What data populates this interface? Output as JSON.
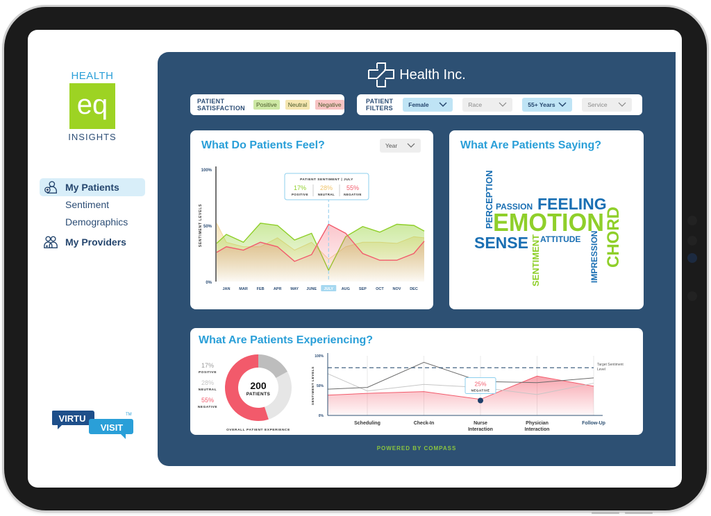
{
  "sidebar": {
    "logo": {
      "top": "HEALTH",
      "mark": "eq",
      "bottom": "INSIGHTS"
    },
    "nav": [
      {
        "label": "My Patients",
        "icon": "patient-icon",
        "active": true
      },
      {
        "label": "Sentiment"
      },
      {
        "label": "Demographics"
      },
      {
        "label": "My Providers",
        "icon": "providers-icon",
        "active": false
      }
    ],
    "partner_logo": {
      "part1": "VIRTU",
      "part2": "VISIT",
      "tm": "TM"
    }
  },
  "header": {
    "brand": "Health Inc."
  },
  "satisfaction": {
    "label_line1": "PATIENT",
    "label_line2": "SATISFACTION",
    "chips": [
      {
        "label": "Positive",
        "color": "#cde8a4"
      },
      {
        "label": "Neutral",
        "color": "#f5e6b0"
      },
      {
        "label": "Negative",
        "color": "#f8c3c3"
      }
    ]
  },
  "filters": {
    "label_line1": "PATIENT",
    "label_line2": "FILTERS",
    "selects": [
      {
        "value": "Female",
        "active": true
      },
      {
        "value": "Race",
        "active": false
      },
      {
        "value": "55+ Years",
        "active": true
      },
      {
        "value": "Service",
        "active": false
      }
    ]
  },
  "feel": {
    "title": "What Do Patients Feel?",
    "period_select": "Year",
    "tooltip": {
      "title": "PATIENT SENTIMENT | JULY",
      "positive": "17%",
      "positive_label": "POSITIVE",
      "neutral": "28%",
      "neutral_label": "NEUTRAL",
      "negative": "55%",
      "negative_label": "NEGATIVE"
    }
  },
  "saying": {
    "title": "What Are Patients Saying?",
    "words": [
      "PERCEPTION",
      "PASSION",
      "FEELING",
      "EMOTION",
      "SENSE",
      "ATTITUDE",
      "SENTIMENT",
      "IMPRESSION",
      "CHORD"
    ]
  },
  "experiencing": {
    "title": "What Are Patients Experiencing?",
    "donut_center_value": "200",
    "donut_center_label": "PATIENTS",
    "donut_caption": "OVERALL PATIENT EXPERIENCE",
    "legend": [
      {
        "value": "17%",
        "label": "POSITIVE",
        "color": "#9a9a9a"
      },
      {
        "value": "28%",
        "label": "NEUTRAL",
        "color": "#c4c4c4"
      },
      {
        "value": "55%",
        "label": "NEGATIVE",
        "color": "#f25a6b"
      }
    ],
    "tooltip": {
      "value": "25%",
      "label": "NEGATIVE"
    },
    "target_label_line1": "Target Sentiment",
    "target_label_line2": "Level"
  },
  "footer": {
    "text": "POWERED BY COMPASS"
  },
  "colors": {
    "panel": "#2d5073",
    "accent": "#2a9fd8",
    "positive": "#8fcf2a",
    "neutral": "#f0c46a",
    "negative": "#f25a6b"
  },
  "chart_data": [
    {
      "type": "area",
      "title": "What Do Patients Feel?",
      "ylabel": "SENTIMENT LEVELS",
      "ylim": [
        0,
        100
      ],
      "yticks": [
        "0%",
        "50%",
        "100%"
      ],
      "categories": [
        "JAN",
        "MAR",
        "FEB",
        "APR",
        "MAY",
        "JUNE",
        "JULY",
        "AUG",
        "SEP",
        "OCT",
        "NOV",
        "DEC"
      ],
      "highlighted_category": "JULY",
      "series": [
        {
          "name": "Positive",
          "start": 34,
          "values": [
            42,
            35,
            52,
            50,
            37,
            43,
            10,
            40,
            49,
            44,
            51,
            50
          ],
          "end": 45
        },
        {
          "name": "Neutral",
          "start": 52,
          "values": [
            35,
            31,
            31,
            39,
            28,
            35,
            20,
            31,
            35,
            35,
            34,
            40
          ],
          "end": 39
        },
        {
          "name": "Negative",
          "start": 26,
          "values": [
            31,
            28,
            35,
            31,
            18,
            24,
            51,
            43,
            25,
            19,
            19,
            25
          ],
          "end": 36
        }
      ]
    },
    {
      "type": "pie",
      "title": "Overall Patient Experience",
      "categories": [
        "Positive",
        "Neutral",
        "Negative"
      ],
      "values": [
        17,
        28,
        55
      ],
      "total_patients": 200
    },
    {
      "type": "line",
      "title": "What Are Patients Experiencing?",
      "ylabel": "SENTIMENT LEVELS",
      "ylim": [
        0,
        100
      ],
      "yticks": [
        "0%",
        "50%",
        "100%"
      ],
      "categories": [
        "Scheduling",
        "Check-In",
        "Nurse Interaction",
        "Physician Interaction",
        "Follow-Up"
      ],
      "target": 80,
      "series": [
        {
          "name": "Positive",
          "start": 44,
          "values": [
            47,
            89,
            57,
            55,
            63
          ]
        },
        {
          "name": "Neutral",
          "start": 70,
          "values": [
            41,
            52,
            47,
            35,
            54
          ]
        },
        {
          "name": "Negative",
          "start": 34,
          "values": [
            37,
            40,
            27,
            66,
            49
          ]
        }
      ],
      "highlight": {
        "category": "Nurse Interaction",
        "series": "Negative",
        "value": 25
      }
    }
  ]
}
